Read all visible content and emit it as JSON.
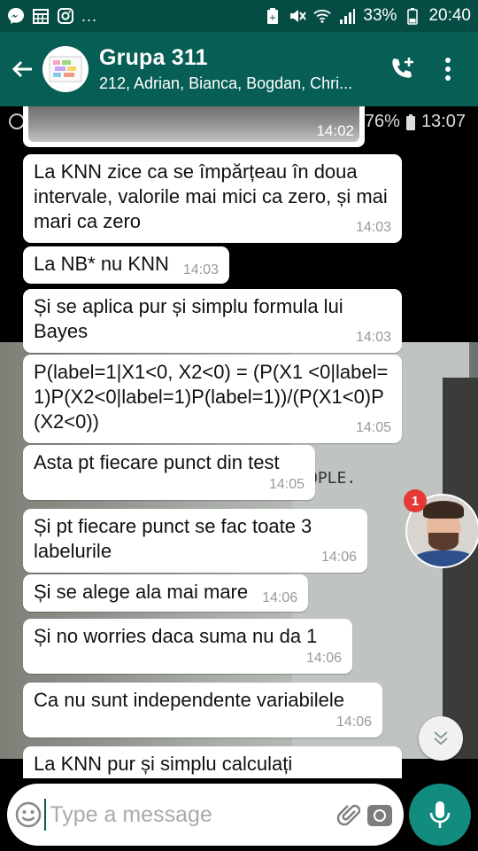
{
  "status_bar": {
    "left_icons": [
      "messenger-icon",
      "calendar-grid-icon",
      "instagram-icon"
    ],
    "overflow": "...",
    "battery": "33%",
    "time": "20:40"
  },
  "header": {
    "title": "Grupa 311",
    "subtitle": "212, Adrian, Bianca, Bogdan, Chri..."
  },
  "overlay_status": {
    "battery": "76%",
    "time": "13:07"
  },
  "image_message": {
    "time": "14:02"
  },
  "messages": [
    {
      "text": "La KNN zice ca se împărțeau în doua intervale, valorile mai mici ca zero, și mai mari ca zero",
      "time": "14:03"
    },
    {
      "text": "La NB* nu KNN",
      "time": "14:03"
    },
    {
      "text": "Și se aplica pur și simplu formula lui Bayes",
      "time": "14:03"
    },
    {
      "text": "P(label=1|X1<0, X2<0) = (P(X1 <0|label=1)P(X2<0|label=1)P(label=1))/(P(X1<0)P(X2<0))",
      "time": "14:05"
    },
    {
      "text": "Asta pt fiecare punct din test",
      "time": "14:05"
    },
    {
      "text": "Și pt fiecare punct se fac toate 3 labelurile",
      "time": "14:06"
    },
    {
      "text": "Și se alege ala mai mare",
      "time": "14:06"
    },
    {
      "text": "Și no worries daca suma nu da 1",
      "time": "14:06"
    },
    {
      "text": "Ca nu sunt independente variabilele",
      "time": "14:06"
    },
    {
      "text": "La KNN pur și simplu calculați",
      "time": ""
    }
  ],
  "background_sign": "OPLE.",
  "floating_chat": {
    "unread_count": "1"
  },
  "composer": {
    "placeholder": "Type a message"
  },
  "colors": {
    "header": "#075e54",
    "status": "#054d44",
    "accent": "#128c7e",
    "badge": "#e53935"
  }
}
